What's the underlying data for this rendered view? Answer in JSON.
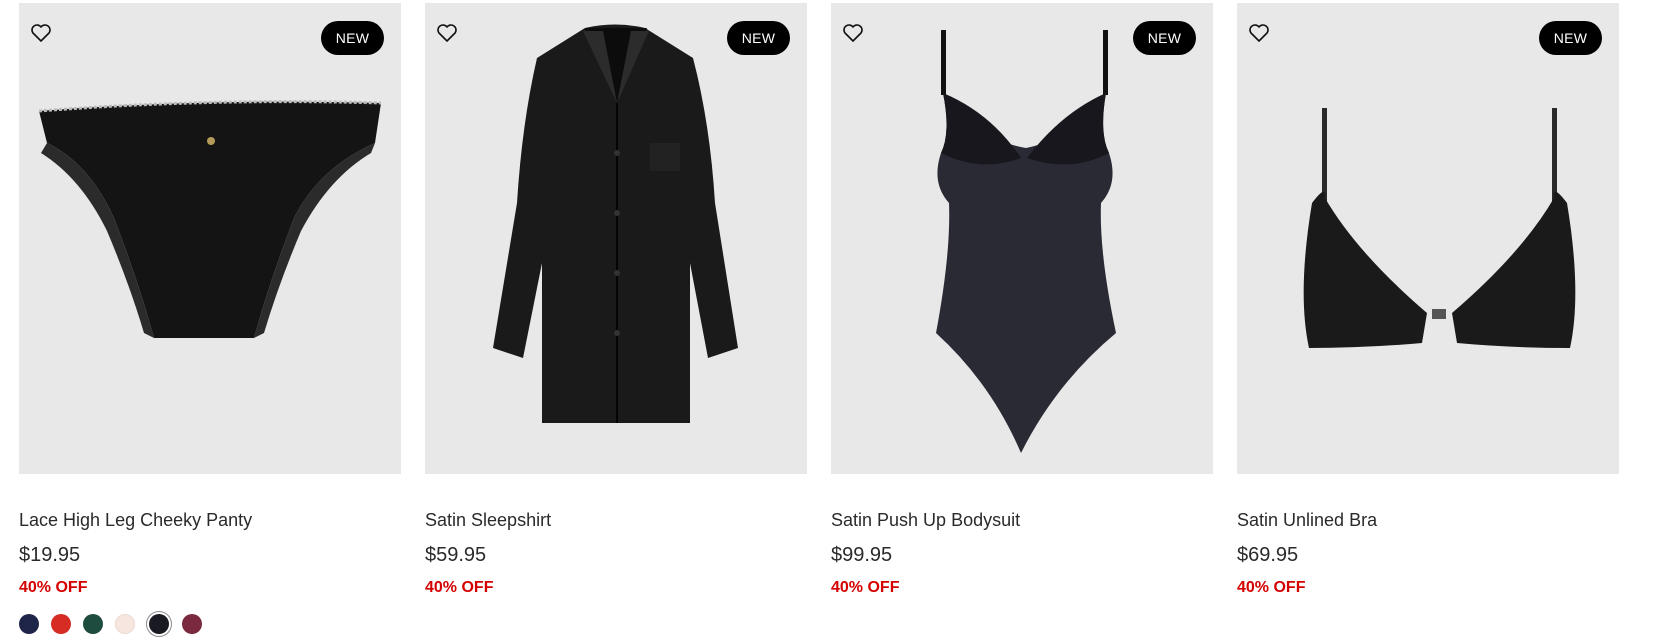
{
  "products": [
    {
      "badge": "NEW",
      "name": "Lace High Leg Cheeky Panty",
      "price": "$19.95",
      "discount": "40% OFF",
      "image_icon": "black-lace-panty-image",
      "swatches": [
        {
          "color": "#1f2548"
        },
        {
          "color": "#d52c24"
        },
        {
          "color": "#1e4d40"
        },
        {
          "color": "#f6e6df"
        },
        {
          "color": "#1a1b22",
          "selected": true
        },
        {
          "color": "#7a2a3c"
        }
      ]
    },
    {
      "badge": "NEW",
      "name": "Satin Sleepshirt",
      "price": "$59.95",
      "discount": "40% OFF",
      "image_icon": "black-satin-sleepshirt-image"
    },
    {
      "badge": "NEW",
      "name": "Satin Push Up Bodysuit",
      "price": "$99.95",
      "discount": "40% OFF",
      "image_icon": "black-satin-bodysuit-image"
    },
    {
      "badge": "NEW",
      "name": "Satin Unlined Bra",
      "price": "$69.95",
      "discount": "40% OFF",
      "image_icon": "black-satin-bra-image"
    }
  ],
  "colors": {
    "discount": "#d40000",
    "badge_bg": "#000000",
    "image_bg": "#e8e8e8"
  }
}
